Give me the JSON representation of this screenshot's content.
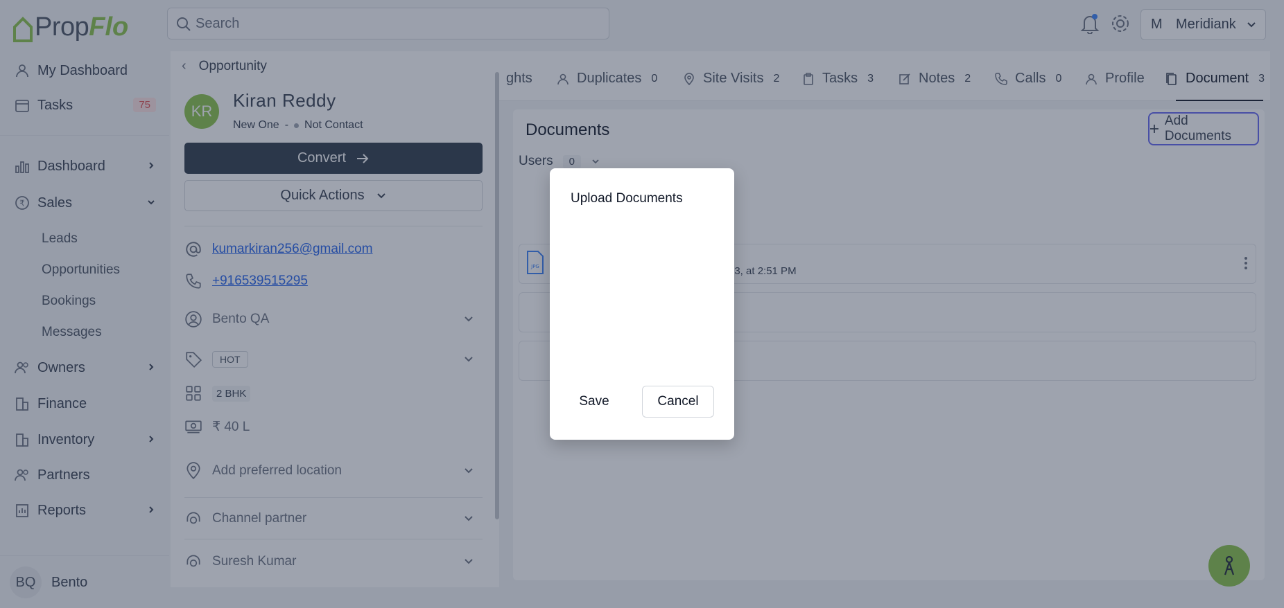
{
  "app": {
    "logo_part1": "Prop",
    "logo_part2": "Flo"
  },
  "search": {
    "placeholder": "Search"
  },
  "header": {
    "workspace_initial": "M",
    "workspace_name": "Meridiank"
  },
  "sidebar": {
    "my_dashboard": "My Dashboard",
    "tasks": "Tasks",
    "tasks_count": "75",
    "dashboard": "Dashboard",
    "sales": "Sales",
    "sales_sub": [
      "Leads",
      "Opportunities",
      "Bookings",
      "Messages"
    ],
    "owners": "Owners",
    "finance": "Finance",
    "inventory": "Inventory",
    "partners": "Partners",
    "reports": "Reports",
    "user_initials": "BQ",
    "user_name": "Bento"
  },
  "profile": {
    "breadcrumb": "Opportunity",
    "avatar_initials": "KR",
    "first_name": "Kiran",
    "last_name": "Reddy",
    "stage": "New One",
    "separator": "-",
    "status": "Not Contact",
    "convert_label": "Convert",
    "quick_actions_label": "Quick Actions",
    "email": "kumarkiran256@gmail.com",
    "phone": "+916539515295",
    "assignee": "Bento QA",
    "tag": "HOT",
    "config": "2 BHK",
    "budget": "₹ 40 L",
    "location_placeholder": "Add preferred location",
    "channel_partner": "Channel partner",
    "sourcing_manager": "Suresh Kumar"
  },
  "tabs": [
    {
      "label": "ghts",
      "count": ""
    },
    {
      "label": "Duplicates",
      "count": "0"
    },
    {
      "label": "Site Visits",
      "count": "2"
    },
    {
      "label": "Tasks",
      "count": "3"
    },
    {
      "label": "Notes",
      "count": "2"
    },
    {
      "label": "Calls",
      "count": "0"
    },
    {
      "label": "Profile",
      "count": ""
    },
    {
      "label": "Document",
      "count": "3"
    }
  ],
  "documents": {
    "title": "Documents",
    "add_label": "Add Documents",
    "users_label": "Users",
    "users_count": "0",
    "first_doc_meta": "23, at 2:51 PM",
    "file_type": "JPG"
  },
  "modal": {
    "title": "Upload Documents",
    "save_label": "Save",
    "cancel_label": "Cancel"
  },
  "colors": {
    "brand_green": "#8bc34a",
    "accent_indigo": "#6366f1",
    "convert_dark": "#2f3b4a"
  }
}
